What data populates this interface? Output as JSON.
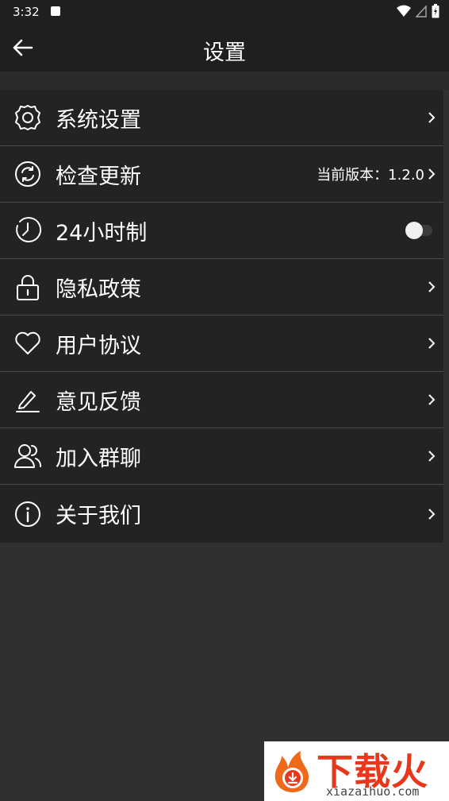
{
  "status_bar": {
    "time": "3:32"
  },
  "header": {
    "title": "设置"
  },
  "menu": {
    "items": [
      {
        "label": "系统设置",
        "icon": "gear-icon"
      },
      {
        "label": "检查更新",
        "icon": "refresh-icon",
        "value": "当前版本：1.2.0"
      },
      {
        "label": "24小时制",
        "icon": "clock-icon",
        "toggle_on": false
      },
      {
        "label": "隐私政策",
        "icon": "lock-icon"
      },
      {
        "label": "用户协议",
        "icon": "heart-icon"
      },
      {
        "label": "意见反馈",
        "icon": "edit-icon"
      },
      {
        "label": "加入群聊",
        "icon": "users-icon"
      },
      {
        "label": "关于我们",
        "icon": "info-icon"
      }
    ]
  },
  "watermark": {
    "title": "下载火",
    "url": "xiazaihuo.com"
  },
  "colors": {
    "background": "#313031",
    "bar": "#1f1f1f",
    "list": "#232323",
    "accent": "#e8371b"
  }
}
